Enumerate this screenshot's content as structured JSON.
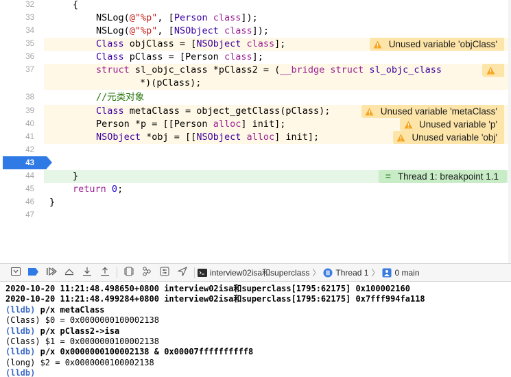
{
  "editor": {
    "line_numbers": [
      "32",
      "33",
      "34",
      "35",
      "36",
      "37",
      "",
      "38",
      "39",
      "40",
      "41",
      "42",
      "43",
      "44",
      "45",
      "46",
      "47"
    ],
    "active_line": "43",
    "lines": {
      "l32": "{",
      "l33_fn": "NSLog(",
      "l33_str": "@\"%p\"",
      "l33_rest_a": ", [",
      "l33_type": "Person",
      "l33_sp": " ",
      "l33_cls": "class",
      "l33_end": "]);",
      "l34_fn": "NSLog(",
      "l34_str": "@\"%p\"",
      "l34_rest_a": ", [",
      "l34_type": "NSObject",
      "l34_sp": " ",
      "l34_cls": "class",
      "l34_end": "]);",
      "l35_type": "Class",
      "l35_mid": " objClass = [",
      "l35_type2": "NSObject",
      "l35_sp": " ",
      "l35_cls": "class",
      "l35_end": "];",
      "l36_type": "Class",
      "l36_mid": " pClass = [Person ",
      "l36_cls": "class",
      "l36_end": "];",
      "l37_kw": "struct",
      "l37_mid": " sl_objc_class *pClass2 = (",
      "l37_kw2": "__bridge",
      "l37_sp": " ",
      "l37_kw3": "struct",
      "l37_sp2": " ",
      "l37_type": "sl_objc_class",
      "l37_cont": "*)(pClass);",
      "l38_comment": "//元类对象",
      "l39_type": "Class",
      "l39_rest": " metaClass = object_getClass(pClass);",
      "l40_a": "Person *p = [[Person ",
      "l40_kw": "alloc",
      "l40_b": "] init];",
      "l41_type": "NSObject",
      "l41_mid": " *obj = [[",
      "l41_type2": "NSObject",
      "l41_sp": " ",
      "l41_kw": "alloc",
      "l41_b": "] init];",
      "l44": "}",
      "l45_kw": "return",
      "l45_sp": " ",
      "l45_num": "0",
      "l45_end": ";",
      "l46": "}"
    },
    "warnings": {
      "objClass": "Unused variable 'objClass'",
      "metaClass": "Unused variable 'metaClass'",
      "p": "Unused variable 'p'",
      "obj": "Unused variable 'obj'"
    },
    "breakpoint_badge": "Thread 1: breakpoint 1.1",
    "colors": {
      "keyword": "#9b2393",
      "type": "#3900a0",
      "string": "#c41a16",
      "number": "#1c00cf",
      "comment": "#267507",
      "warning_bg": "#fde5a9",
      "breakpoint_bg": "#c7ecc6",
      "active_line_marker": "#2f7ae5"
    }
  },
  "debug_bar": {
    "icons": [
      "hide-console-icon",
      "breakpoints-toggle-icon",
      "continue-icon",
      "step-over-icon",
      "step-into-icon",
      "step-out-icon",
      "view-hierarchy-icon",
      "memory-graph-icon",
      "environment-overrides-icon",
      "simulate-location-icon"
    ],
    "breadcrumbs": {
      "target": "interview02isa和superclass",
      "thread": "Thread 1",
      "frame": "0 main"
    }
  },
  "console": {
    "log1": "2020-10-20 11:21:48.498650+0800 interview02isa和superclass[1795:62175] 0x100002160",
    "log2": "2020-10-20 11:21:48.499284+0800 interview02isa和superclass[1795:62175] 0x7fff994fa118",
    "prompt": "(lldb)",
    "cmd1": "p/x metaClass",
    "out1": "(Class) $0 = 0x0000000100002138",
    "cmd2": "p/x pClass2->isa",
    "out2": "(Class) $1 = 0x0000000100002138",
    "cmd3": "p/x 0x0000000100002138 & 0x00007ffffffffff8",
    "out3": "(long) $2 = 0x0000000100002138"
  }
}
